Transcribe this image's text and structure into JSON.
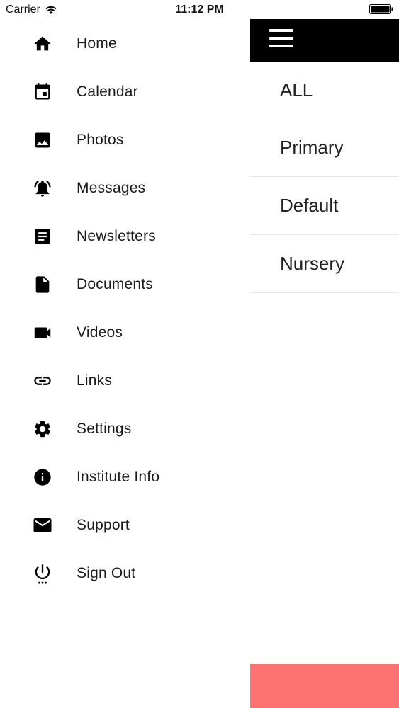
{
  "status_bar": {
    "carrier": "Carrier",
    "time": "11:12 PM"
  },
  "drawer": {
    "items": [
      {
        "label": "Home",
        "icon": "home-icon"
      },
      {
        "label": "Calendar",
        "icon": "calendar-icon"
      },
      {
        "label": "Photos",
        "icon": "photo-icon"
      },
      {
        "label": "Messages",
        "icon": "bell-icon"
      },
      {
        "label": "Newsletters",
        "icon": "newsletter-icon"
      },
      {
        "label": "Documents",
        "icon": "document-icon"
      },
      {
        "label": "Videos",
        "icon": "video-icon"
      },
      {
        "label": "Links",
        "icon": "link-icon"
      },
      {
        "label": "Settings",
        "icon": "gear-icon"
      },
      {
        "label": "Institute Info",
        "icon": "info-icon"
      },
      {
        "label": "Support",
        "icon": "mail-icon"
      },
      {
        "label": "Sign Out",
        "icon": "power-icon"
      }
    ]
  },
  "main": {
    "categories": [
      "ALL",
      "Primary",
      "Default",
      "Nursery"
    ]
  },
  "colors": {
    "header": "#000000",
    "accent": "#ff7272",
    "divider": "#e6e6e6"
  }
}
